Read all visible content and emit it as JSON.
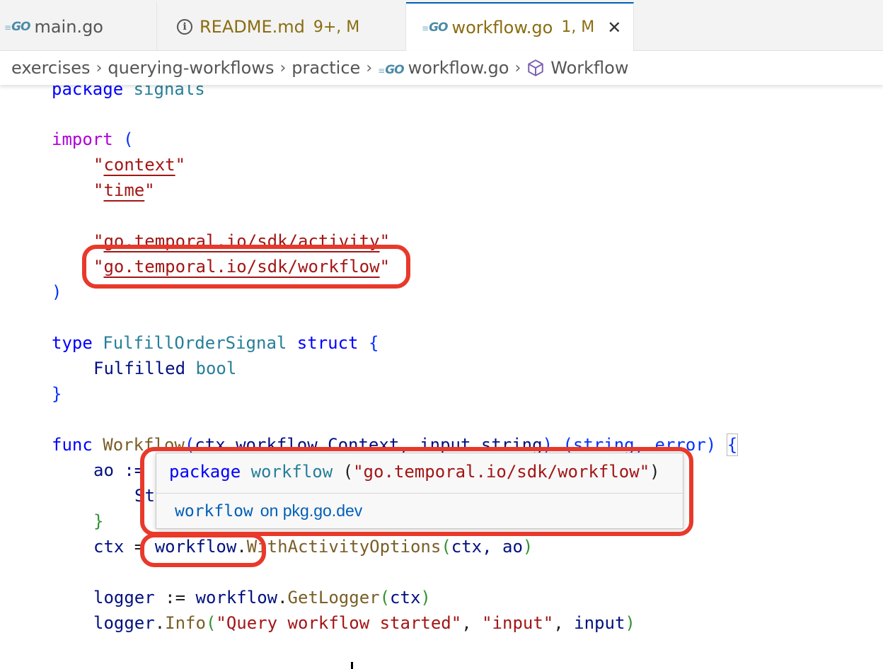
{
  "tabs": [
    {
      "label": "main.go",
      "icon": "go-file-icon",
      "badge": ""
    },
    {
      "label": "README.md",
      "icon": "info-icon",
      "badge": "9+, M"
    },
    {
      "label": "workflow.go",
      "icon": "go-file-icon",
      "badge": "1, M",
      "active": true
    }
  ],
  "close_glyph": "✕",
  "breadcrumb": [
    "exercises",
    "querying-workflows",
    "practice",
    "workflow.go",
    "Workflow"
  ],
  "code": {
    "l1_kw": "package",
    "l1_name": "signals",
    "l3_kw": "import",
    "l3_paren": "(",
    "imp_context": "context",
    "imp_time": "time",
    "imp_activity": "go.temporal.io/sdk/activity",
    "imp_workflow": "go.temporal.io/sdk/workflow",
    "close_paren": ")",
    "type_kw": "type",
    "type_name": "FulfillOrderSignal",
    "struct_kw": "struct",
    "brace_open": "{",
    "field_name": "Fulfilled",
    "field_type": "bool",
    "brace_close": "}",
    "func_kw": "func",
    "func_name": "Workflow",
    "func_params_a": "ctx workflow.Context, input string",
    "func_ret": "(string, error)",
    "ao_line": "ao :=",
    "st_frag": "St",
    "close_brace_green": "}",
    "ctx_var": "ctx",
    "assign": " = ",
    "pkg_workflow": "workflow",
    "with_fn": "WithActivityOptions",
    "with_args": "ctx, ao",
    "logger_var": "logger",
    "decl": " := ",
    "get_logger": "GetLogger",
    "info_fn": "Info",
    "info_msg": "\"Query workflow started\"",
    "info_key": "\"input\"",
    "info_val": "input"
  },
  "hover": {
    "kw": "package",
    "name": "workflow",
    "path": "\"go.temporal.io/sdk/workflow\"",
    "link_code": "workflow",
    "link_text": "on pkg.go.dev"
  },
  "colors": {
    "annotation": "#e8392b",
    "accent": "#005fb8"
  }
}
